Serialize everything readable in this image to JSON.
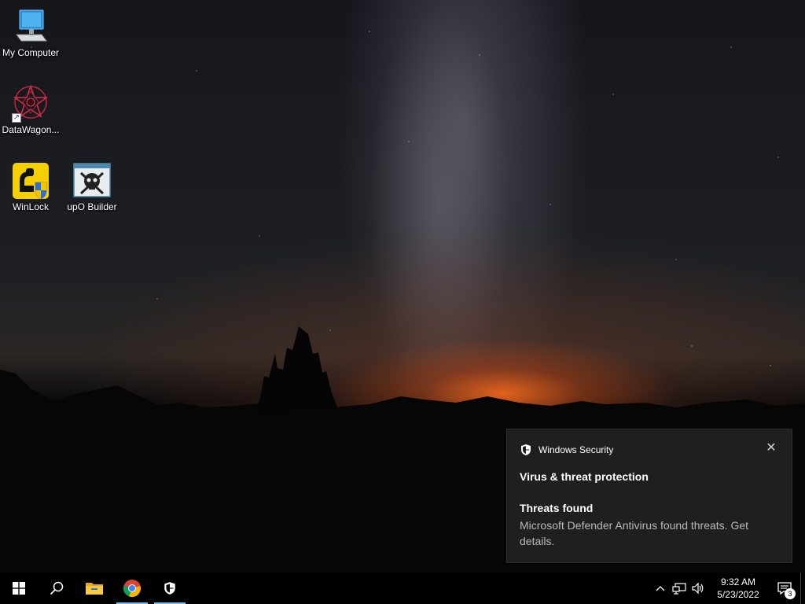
{
  "desktop": {
    "icons": [
      {
        "label": "My Computer"
      },
      {
        "label": "DataWagon..."
      },
      {
        "label": "WinLock"
      },
      {
        "label": "upO Builder"
      }
    ]
  },
  "toast": {
    "app_name": "Windows Security",
    "title": "Virus & threat protection",
    "subtitle": "Threats found",
    "body": "Microsoft Defender Antivirus found threats. Get details.",
    "close_glyph": "✕"
  },
  "taskbar": {
    "buttons": [
      "windows-start",
      "search",
      "file-explorer",
      "chrome",
      "windows-security"
    ],
    "clock": {
      "time": "9:32 AM",
      "date": "5/23/2022"
    },
    "notification_count": "3"
  },
  "colors": {
    "toast_bg": "#1f1f1f",
    "taskbar_bg": "#000000",
    "running_indicator": "#76b9ed",
    "winlock_yellow": "#f5d000"
  }
}
